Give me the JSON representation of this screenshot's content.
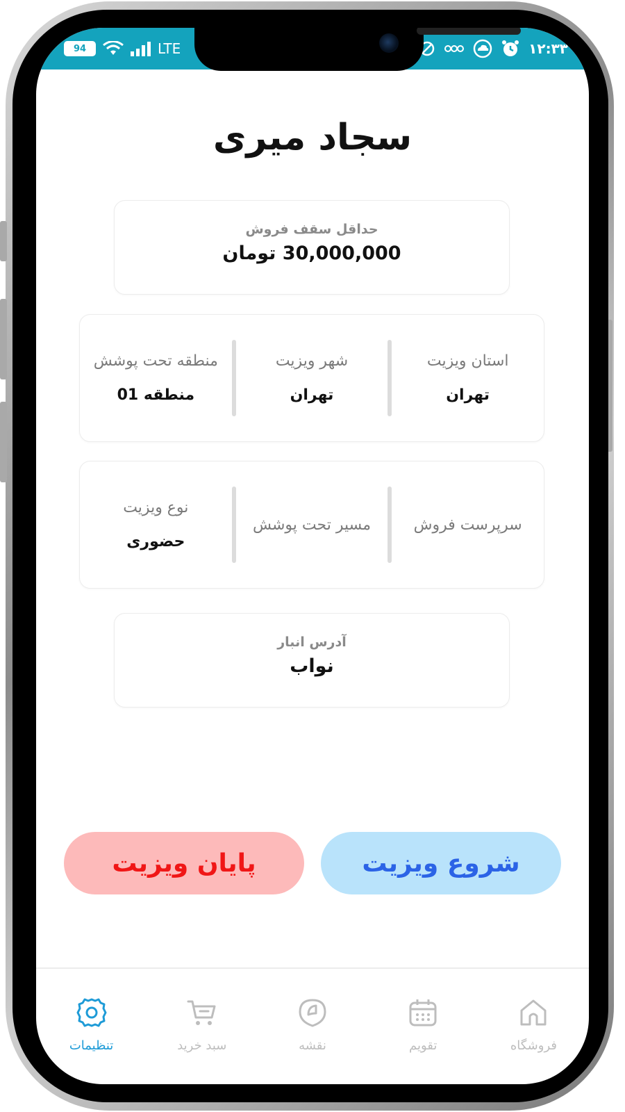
{
  "status_bar": {
    "time": "۱۲:۳۳",
    "battery": "94",
    "network": "LTE"
  },
  "page": {
    "title": "سجاد میری"
  },
  "sales_cap": {
    "label": "حداقل سقف فروش",
    "value": "30,000,000 تومان"
  },
  "location": [
    {
      "label": "استان ویزیت",
      "value": "تهران"
    },
    {
      "label": "شهر ویزیت",
      "value": "تهران"
    },
    {
      "label": "منطقه تحت پوشش",
      "value": "منطقه 01"
    }
  ],
  "visit_info": [
    {
      "label": "سرپرست فروش",
      "value": ""
    },
    {
      "label": "مسیر تحت پوشش",
      "value": ""
    },
    {
      "label": "نوع ویزیت",
      "value": "حضوری"
    }
  ],
  "warehouse": {
    "label": "آدرس انبار",
    "value": "نواب"
  },
  "actions": {
    "start_label": "شروع ویزیت",
    "end_label": "پایان ویزیت"
  },
  "nav": [
    {
      "label": "فروشگاه",
      "icon": "store-icon",
      "active": false
    },
    {
      "label": "تقویم",
      "icon": "calendar-icon",
      "active": false
    },
    {
      "label": "نقشه",
      "icon": "map-icon",
      "active": false
    },
    {
      "label": "سبد خرید",
      "icon": "cart-icon",
      "active": false
    },
    {
      "label": "تنظیمات",
      "icon": "gear-icon",
      "active": true
    }
  ],
  "colors": {
    "status_bar": "#14a3bd",
    "start_bg": "#b9e3fb",
    "start_text": "#2b63e6",
    "end_bg": "#fdbaba",
    "end_text": "#f01616",
    "nav_active": "#1e9bd7",
    "nav_inactive": "#bdbdbd"
  }
}
